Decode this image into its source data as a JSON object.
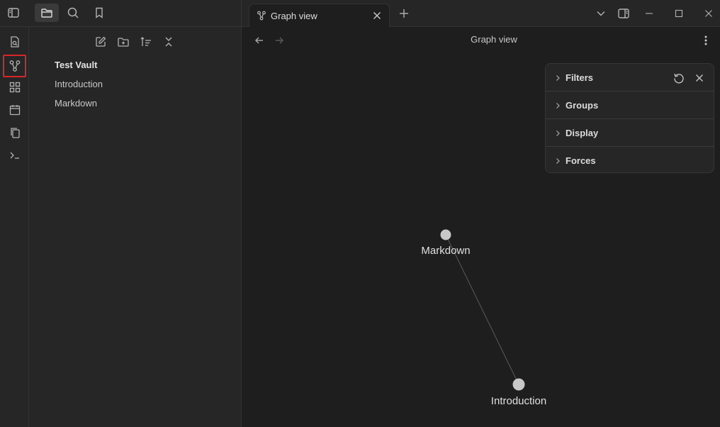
{
  "tab": {
    "title": "Graph view"
  },
  "view": {
    "title": "Graph view"
  },
  "explorer": {
    "vault_name": "Test Vault",
    "files": [
      "Introduction",
      "Markdown"
    ]
  },
  "graph_panel": {
    "sections": [
      "Filters",
      "Groups",
      "Display",
      "Forces"
    ]
  },
  "graph": {
    "nodes": [
      {
        "label": "Markdown"
      },
      {
        "label": "Introduction"
      }
    ],
    "edges": [
      [
        "Markdown",
        "Introduction"
      ]
    ]
  },
  "colors": {
    "background": "#1e1e1e",
    "sidebar": "#262626",
    "node": "#c8c8c8",
    "edge": "#5a5a5a",
    "highlight": "#d9252a"
  }
}
